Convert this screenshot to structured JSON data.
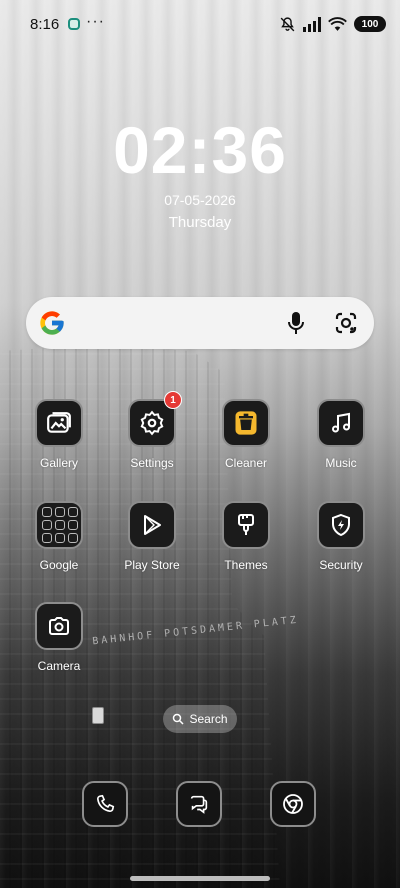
{
  "status_bar": {
    "time": "8:16",
    "app_icon": "app-notification-icon",
    "more": "···",
    "icons": [
      "mute-icon",
      "signal-icon",
      "wifi-icon"
    ],
    "battery": "100"
  },
  "clock": {
    "time": "02:36",
    "date": "07-05-2026",
    "weekday": "Thursday"
  },
  "search_bar": {
    "logo": "google-logo",
    "mic": "mic-icon",
    "lens": "lens-icon"
  },
  "apps": [
    {
      "label": "Gallery",
      "icon": "gallery-icon"
    },
    {
      "label": "Settings",
      "icon": "gear-icon",
      "badge": "1"
    },
    {
      "label": "Cleaner",
      "icon": "trash-icon"
    },
    {
      "label": "Music",
      "icon": "music-note-icon"
    },
    {
      "label": "Google",
      "icon": "folder-icon"
    },
    {
      "label": "Play Store",
      "icon": "play-store-icon"
    },
    {
      "label": "Themes",
      "icon": "brush-icon"
    },
    {
      "label": "Security",
      "icon": "shield-bolt-icon"
    },
    {
      "label": "Camera",
      "icon": "camera-icon"
    }
  ],
  "search_pill": {
    "label": "Search",
    "icon": "search-icon"
  },
  "dock": [
    {
      "icon": "phone-icon"
    },
    {
      "icon": "messages-icon"
    },
    {
      "icon": "chrome-icon"
    }
  ],
  "colors": {
    "badge": "#e53935",
    "cleaner_accent": "#f5b82e"
  }
}
